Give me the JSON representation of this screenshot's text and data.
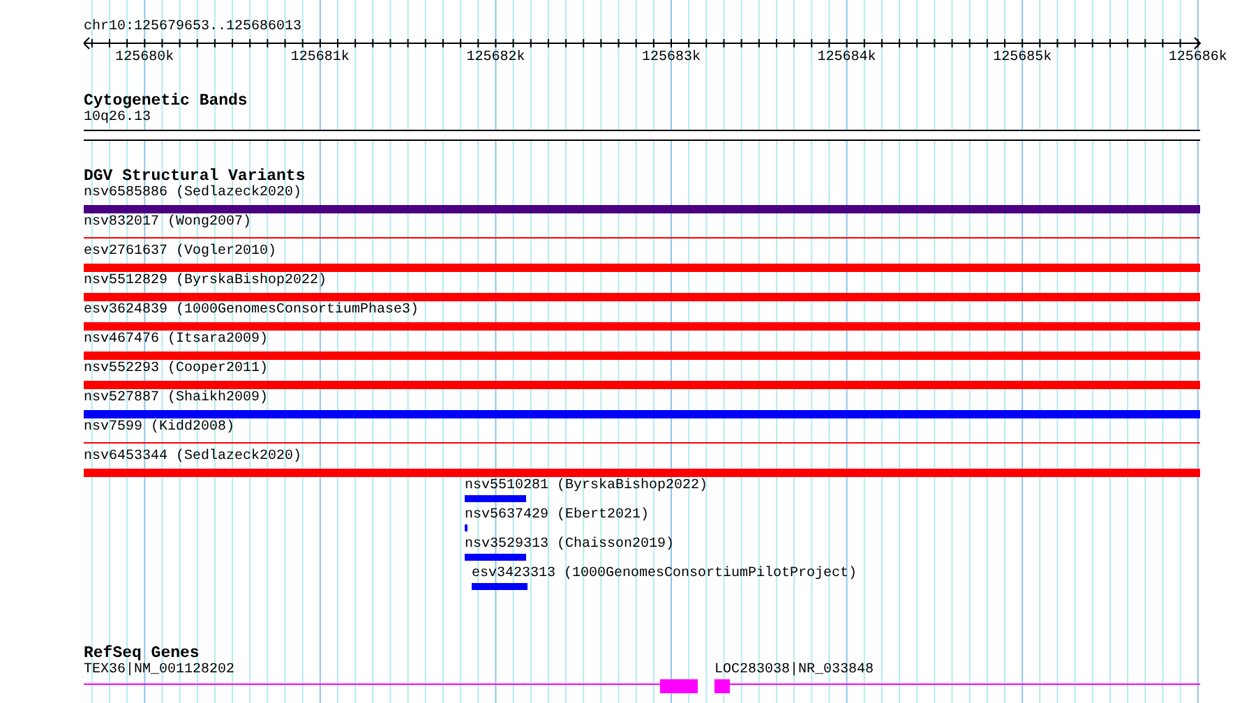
{
  "view": {
    "region": "chr10:125679653..125686013"
  },
  "ruler": {
    "ticks": [
      {
        "label": "125680k"
      },
      {
        "label": "125681k"
      },
      {
        "label": "125682k"
      },
      {
        "label": "125683k"
      },
      {
        "label": "125684k"
      },
      {
        "label": "125685k"
      },
      {
        "label": "125686k"
      }
    ]
  },
  "cytogenetic_bands": {
    "title": "Cytogenetic Bands",
    "band": {
      "name": "10q26.13"
    }
  },
  "dgv_track": {
    "title": "DGV Structural Variants",
    "features": [
      {
        "label": "nsv6585886 (Sedlazeck2020)",
        "kind": "bar",
        "color": "#4b0082"
      },
      {
        "label": "nsv832017 (Wong2007)",
        "kind": "line",
        "color": "#ff0000"
      },
      {
        "label": "esv2761637 (Vogler2010)",
        "kind": "bar",
        "color": "#ff0000"
      },
      {
        "label": "nsv5512829 (ByrskaBishop2022)",
        "kind": "bar",
        "color": "#ff0000"
      },
      {
        "label": "esv3624839 (1000GenomesConsortiumPhase3)",
        "kind": "bar",
        "color": "#ff0000"
      },
      {
        "label": "nsv467476 (Itsara2009)",
        "kind": "bar",
        "color": "#ff0000"
      },
      {
        "label": "nsv552293 (Cooper2011)",
        "kind": "bar",
        "color": "#ff0000"
      },
      {
        "label": "nsv527887 (Shaikh2009)",
        "kind": "bar",
        "color": "#0000ff"
      },
      {
        "label": "nsv7599 (Kidd2008)",
        "kind": "line",
        "color": "#ff0000"
      },
      {
        "label": "nsv6453344 (Sedlazeck2020)",
        "kind": "bar",
        "color": "#ff0000"
      },
      {
        "label": "nsv5510281 (ByrskaBishop2022)",
        "kind": "bar",
        "color": "#0000ff"
      },
      {
        "label": "nsv5637429 (Ebert2021)",
        "kind": "bar",
        "color": "#0000ff"
      },
      {
        "label": "nsv3529313 (Chaisson2019)",
        "kind": "bar",
        "color": "#0000ff"
      },
      {
        "label": "esv3423313 (1000GenomesConsortiumPilotProject)",
        "kind": "bar",
        "color": "#0000ff"
      }
    ]
  },
  "refseq_track": {
    "title": "RefSeq Genes",
    "genes": [
      {
        "label": "TEX36|NM_001128202"
      },
      {
        "label": "LOC283038|NR_033848"
      }
    ]
  }
}
